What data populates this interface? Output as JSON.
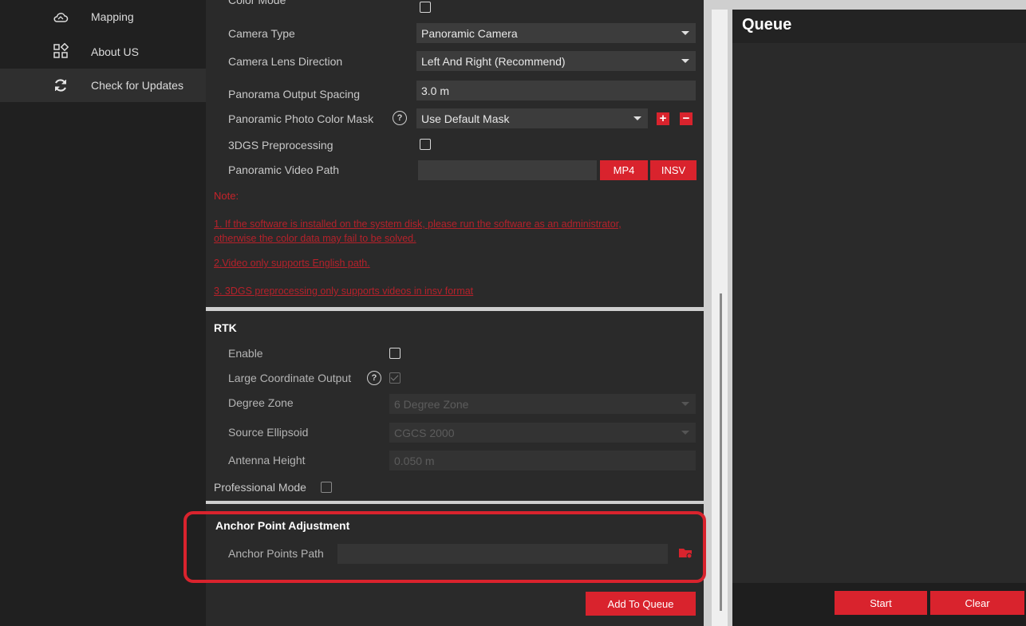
{
  "sidebar": {
    "items": [
      {
        "label": "Mapping",
        "icon": "cloud-icon"
      },
      {
        "label": "About US",
        "icon": "grid-icon"
      },
      {
        "label": "Check for Updates",
        "icon": "refresh-icon"
      }
    ]
  },
  "camera": {
    "color_mode_label": "Color Mode",
    "camera_type_label": "Camera Type",
    "camera_type_value": "Panoramic Camera",
    "lens_direction_label": "Camera Lens Direction",
    "lens_direction_value": "Left And Right (Recommend)",
    "output_spacing_label": "Panorama Output Spacing",
    "output_spacing_value": "3.0 m",
    "color_mask_label": "Panoramic Photo Color Mask",
    "color_mask_value": "Use Default Mask",
    "add_mask_symbol": "+",
    "remove_mask_symbol": "−",
    "preprocessing_label": "3DGS Preprocessing",
    "video_path_label": "Panoramic Video Path",
    "video_path_value": "",
    "mp4_label": "MP4",
    "insv_label": "INSV"
  },
  "notes": {
    "title": "Note:",
    "line1": "1. If the software is installed on the system disk, please run the software as an administrator, otherwise the color data may fail to be solved.",
    "line2": "2.Video only supports English path.",
    "line3": "3. 3DGS preprocessing only supports videos in insv format"
  },
  "rtk": {
    "title": "RTK",
    "enable_label": "Enable",
    "large_coord_label": "Large Coordinate Output",
    "degree_zone_label": "Degree Zone",
    "degree_zone_value": "6 Degree Zone",
    "ellipsoid_label": "Source Ellipsoid",
    "ellipsoid_value": "CGCS 2000",
    "antenna_label": "Antenna Height",
    "antenna_value": "0.050 m",
    "professional_label": "Professional Mode"
  },
  "anchor": {
    "title": "Anchor Point Adjustment",
    "path_label": "Anchor Points Path",
    "path_value": "",
    "add_to_queue_label": "Add To Queue"
  },
  "queue": {
    "title": "Queue",
    "start_label": "Start",
    "clear_label": "Clear"
  },
  "colors": {
    "accent": "#d9232d",
    "panel": "#2a2a2a",
    "sidebar": "#202020"
  }
}
